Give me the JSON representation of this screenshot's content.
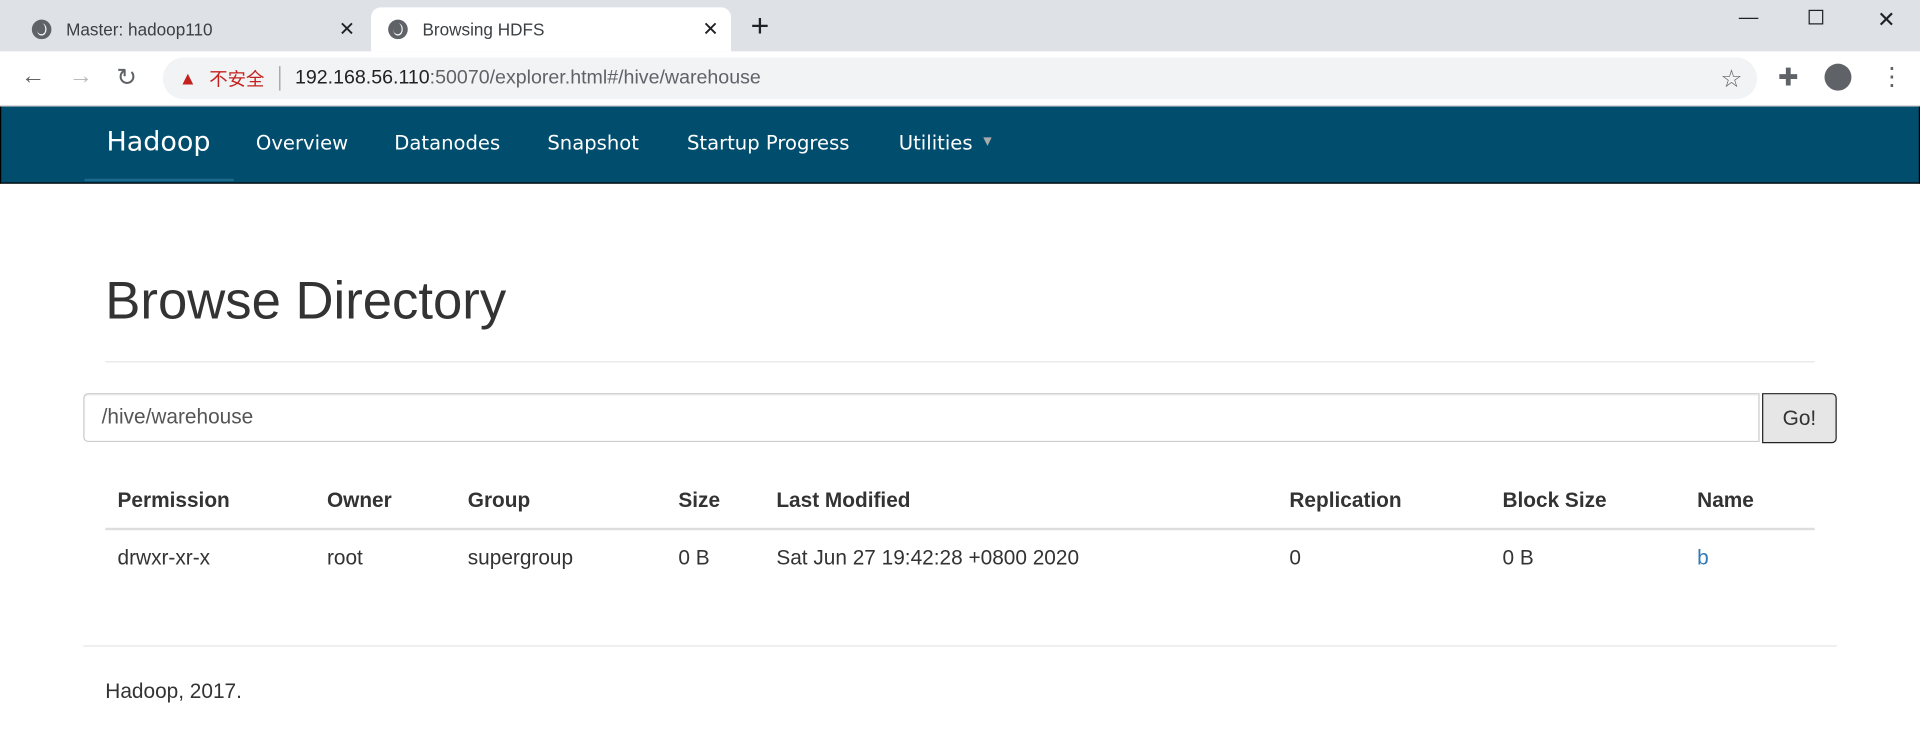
{
  "browser": {
    "tabs": [
      {
        "title": "Master: hadoop110",
        "active": false
      },
      {
        "title": "Browsing HDFS",
        "active": true
      }
    ],
    "security_label": "不安全",
    "url_host": "192.168.56.110",
    "url_rest": ":50070/explorer.html#/hive/warehouse"
  },
  "navbar": {
    "brand": "Hadoop",
    "items": [
      "Overview",
      "Datanodes",
      "Snapshot",
      "Startup Progress",
      "Utilities"
    ],
    "color": "#004d6e"
  },
  "page": {
    "title": "Browse Directory",
    "path_value": "/hive/warehouse",
    "go_label": "Go!"
  },
  "table": {
    "headers": [
      "Permission",
      "Owner",
      "Group",
      "Size",
      "Last Modified",
      "Replication",
      "Block Size",
      "Name"
    ],
    "rows": [
      [
        "drwxr-xr-x",
        "root",
        "supergroup",
        "0 B",
        "Sat Jun 27 19:42:28 +0800 2020",
        "0",
        "0 B",
        "b"
      ]
    ]
  },
  "footer": "Hadoop, 2017."
}
